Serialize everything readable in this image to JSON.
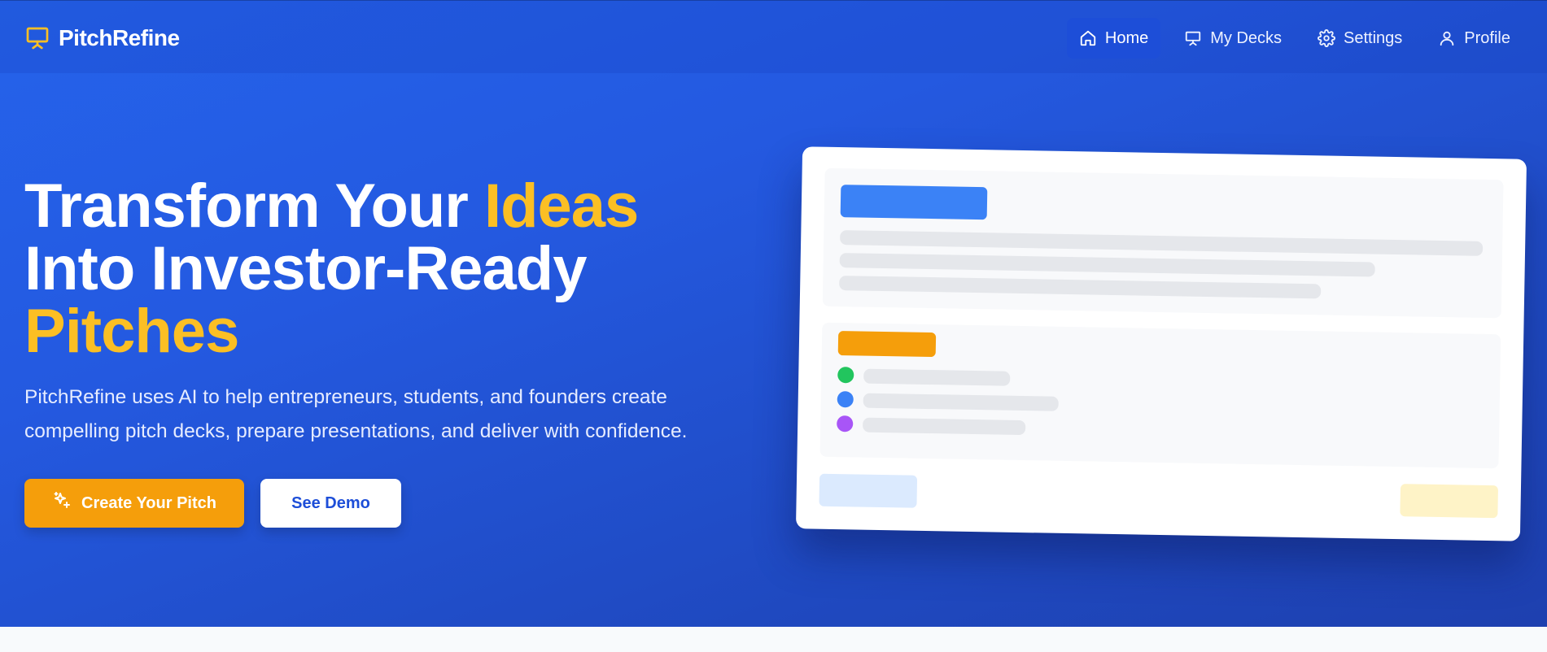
{
  "app": {
    "name": "PitchRefine"
  },
  "icons": {
    "brand": "presentation-board-icon",
    "home": "home-icon",
    "decks": "presentation-icon",
    "settings": "gear-icon",
    "profile": "user-icon",
    "create": "sparkles-icon"
  },
  "nav": {
    "items": [
      {
        "label": "Home",
        "active": true
      },
      {
        "label": "My Decks",
        "active": false
      },
      {
        "label": "Settings",
        "active": false
      },
      {
        "label": "Profile",
        "active": false
      }
    ]
  },
  "hero": {
    "headline_part1": "Transform Your ",
    "headline_highlight1": "Ideas",
    "headline_part2": "Into Investor-Ready",
    "headline_highlight2": "Pitches",
    "subtext": "PitchRefine uses AI to help entrepreneurs, students, and founders create compelling pitch decks, prepare presentations, and deliver with confidence.",
    "primary_cta": "Create Your Pitch",
    "secondary_cta": "See Demo"
  },
  "colors": {
    "accent": "#fbbf24",
    "primary_button": "#f59e0b",
    "hero_bg": "#2563eb",
    "preview_title_bar": "#3b82f6",
    "preview_section_bar": "#f59e0b",
    "dot_green": "#22c55e",
    "dot_blue": "#3b82f6",
    "dot_purple": "#a855f7",
    "preview_left_button": "#dbeafe",
    "preview_right_button": "#fef3c7"
  }
}
